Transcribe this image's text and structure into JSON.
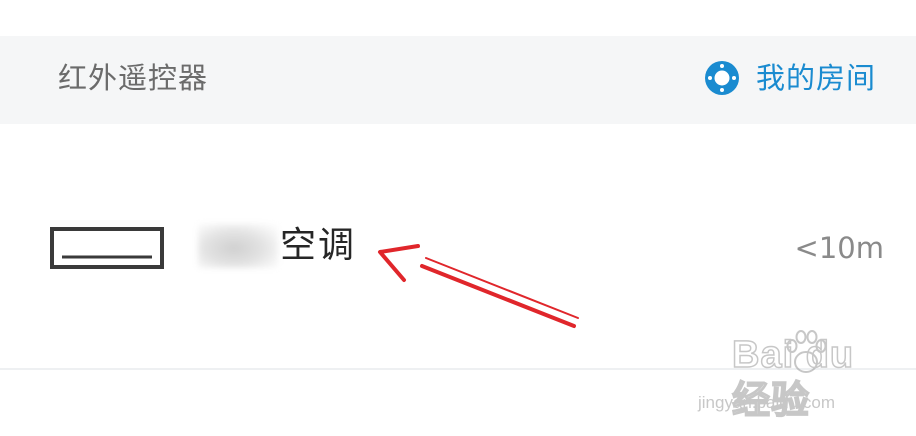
{
  "section": {
    "title": "红外遥控器",
    "room_label": "我的房间"
  },
  "device": {
    "name_suffix": "空调",
    "distance": "<10m"
  },
  "watermark": {
    "logo_text": "Bai du 经验",
    "url": "jingyan.baidu.com"
  },
  "colors": {
    "accent": "#1a8bd0",
    "header_bg": "#f5f6f7",
    "arrow": "#e0262b"
  },
  "icons": {
    "room": "target-ring-icon",
    "device": "air-conditioner-icon",
    "annotation": "red-arrow"
  }
}
